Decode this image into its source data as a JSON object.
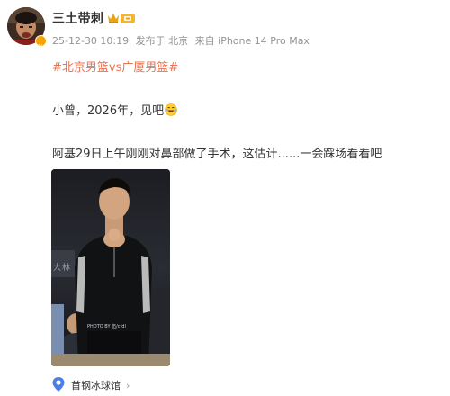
{
  "author": {
    "name": "三土带刺",
    "avatar_icon": "avatar-photo",
    "verified_icon": "verified-badge-icon",
    "vip_icon": "crown-vip-icon"
  },
  "meta": {
    "timestamp": "25-12-30 10:19",
    "posted_from": "发布于 北京",
    "device": "来自 iPhone 14 Pro Max"
  },
  "post": {
    "topic": "#北京男篮vs广厦男篮#",
    "line1": "小曾，2026年，见吧",
    "line1_emoji": "laughing-tears-emoji",
    "line2": "阿基29日上午刚刚对鼻部做了手术，这估计......一会踩场看看吧"
  },
  "image": {
    "watermark": "PHOTO BY 伍/cfdl"
  },
  "location": {
    "icon": "map-pin-icon",
    "name": "首钢冰球馆",
    "chevron": "›"
  },
  "colors": {
    "topic": "#eb7350",
    "meta": "#939393",
    "location_icon": "#4a7fe8",
    "badge": "#f7a400"
  }
}
